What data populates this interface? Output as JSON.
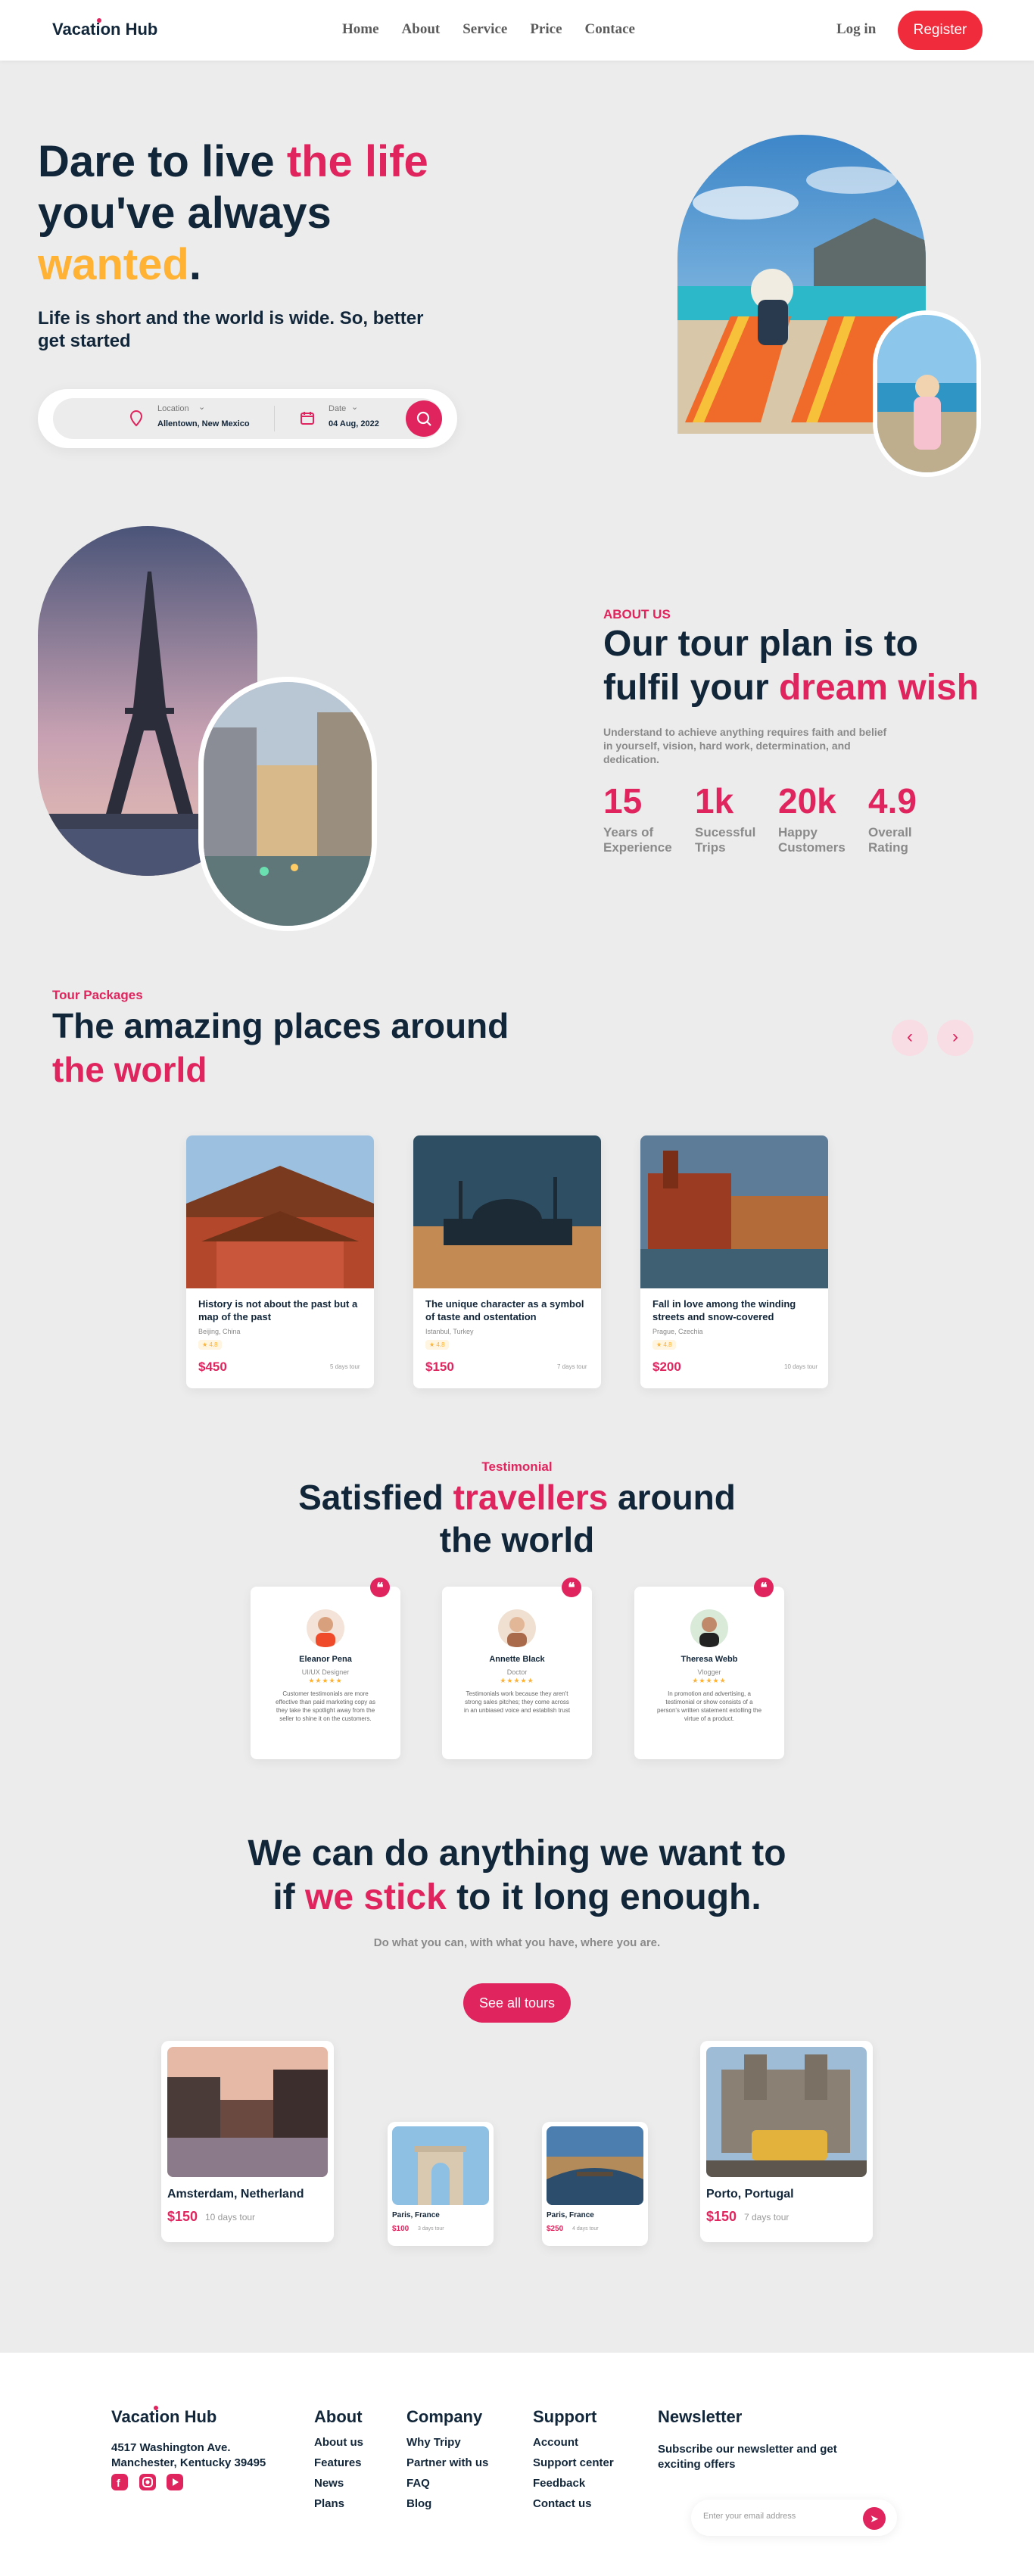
{
  "header": {
    "logo": "Vacation Hub",
    "nav": [
      "Home",
      "About",
      "Service",
      "Price",
      "Contace"
    ],
    "login": "Log in",
    "register": "Register"
  },
  "hero": {
    "title_a": "Dare to live ",
    "title_b": "the life",
    "title_c": "you've always",
    "title_d": "wanted",
    "title_e": ".",
    "subtitle": "Life is short and the world is wide. So, better get started",
    "search": {
      "location_label": "Location",
      "location_value": "Allentown, New Mexico",
      "date_label": "Date",
      "date_value": "04 Aug, 2022"
    }
  },
  "about": {
    "label": "ABOUT US",
    "title_a": "Our tour plan is to",
    "title_b": "fulfil your ",
    "title_c": "dream wish",
    "description": "Understand to achieve anything requires faith and belief in yourself, vision, hard work, determination, and dedication.",
    "stats": [
      {
        "value": "15",
        "label1": "Years of",
        "label2": "Experience"
      },
      {
        "value": "1k",
        "label1": "Sucessful",
        "label2": "Trips"
      },
      {
        "value": "20k",
        "label1": "Happy",
        "label2": "Customers"
      },
      {
        "value": "4.9",
        "label1": "Overall",
        "label2": "Rating"
      }
    ]
  },
  "packages": {
    "label": "Tour Packages",
    "title_a": "The amazing places around",
    "title_b": "the world",
    "prev": "‹",
    "next": "›",
    "cards": [
      {
        "title": "History is not about the past but a map of the past",
        "location": "Beijing, China",
        "rating": "★ 4.8",
        "price": "$450",
        "duration": "5 days tour"
      },
      {
        "title": "The unique character as a symbol of taste and ostentation",
        "location": "Istanbul, Turkey",
        "rating": "★ 4.8",
        "price": "$150",
        "duration": "7 days tour"
      },
      {
        "title": "Fall in love among the winding streets and snow-covered",
        "location": "Prague, Czechia",
        "rating": "★ 4.8",
        "price": "$200",
        "duration": "10 days tour"
      }
    ]
  },
  "testimonial": {
    "label": "Testimonial",
    "title_a": "Satisfied ",
    "title_b": "travellers",
    "title_c": " around",
    "title_d": "the world",
    "cards": [
      {
        "name": "Eleanor Pena",
        "role": "UI/UX Designer",
        "stars": "★★★★★",
        "text": "Customer testimonials are more effective than paid marketing copy as they take the spotlight away from the seller to shine it on the customers."
      },
      {
        "name": "Annette Black",
        "role": "Doctor",
        "stars": "★★★★★",
        "text": "Testimonials work because they aren't strong sales pitches; they come across in an unbiased voice and establish trust"
      },
      {
        "name": "Theresa Webb",
        "role": "Vlogger",
        "stars": "★★★★★",
        "text": "In promotion and advertising, a testimonial or show consists of a person's written statement extolling the virtue of a product."
      }
    ]
  },
  "cta": {
    "title_a": "We can do anything we want to",
    "title_b": "if ",
    "title_c": "we stick",
    "title_d": " to it long enough.",
    "subtitle": "Do what you can, with what you have, where you are.",
    "button": "See all tours",
    "destinations": [
      {
        "name": "Amsterdam, Netherland",
        "price": "$150",
        "duration": "10 days tour"
      },
      {
        "name": "Paris, France",
        "price": "$100",
        "duration": "3 days tour"
      },
      {
        "name": "Paris, France",
        "price": "$250",
        "duration": "4 days tour"
      },
      {
        "name": "Porto, Portugal",
        "price": "$150",
        "duration": "7 days tour"
      }
    ]
  },
  "footer": {
    "logo": "Vacation Hub",
    "address1": "4517 Washington Ave.",
    "address2": "Manchester, Kentucky 39495",
    "about": {
      "title": "About",
      "items": [
        "About us",
        "Features",
        "News",
        "Plans"
      ]
    },
    "company": {
      "title": "Company",
      "items": [
        "Why Tripy",
        "Partner with us",
        "FAQ",
        "Blog"
      ]
    },
    "support": {
      "title": "Support",
      "items": [
        "Account",
        "Support center",
        "Feedback",
        "Contact us"
      ]
    },
    "newsletter": {
      "title": "Newsletter",
      "text": "Subscribe our newsletter and get exciting offers",
      "placeholder": "Enter your email address"
    }
  },
  "colors": {
    "accent": "#e0245e",
    "gold": "#ffb234",
    "dark": "#12263a",
    "register": "#ef2b3c"
  }
}
